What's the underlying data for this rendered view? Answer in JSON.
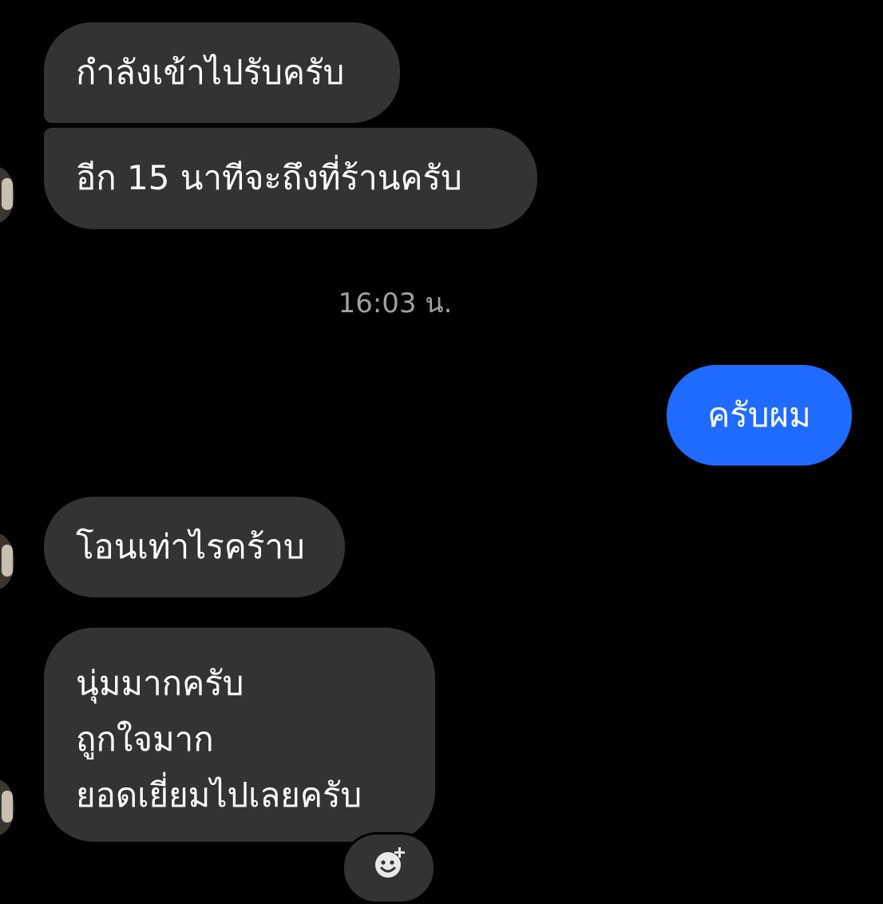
{
  "messages": {
    "incoming_1": "กำลังเข้าไปรับครับ",
    "incoming_2": "อีก 15 นาทีจะถึงที่ร้านครับ",
    "timestamp": "16:03 น.",
    "outgoing_1": "ครับผม",
    "incoming_3": "โอนเท่าไรคร้าบ",
    "incoming_4_lines": [
      "นุ่มมากครับ",
      "ถูกใจมาก",
      "ยอดเยี่ยมไปเลยครับ"
    ]
  },
  "icons": {
    "reaction": "add-reaction-icon",
    "avatar": "contact-avatar"
  },
  "colors": {
    "background": "#000000",
    "incoming_bubble": "#333333",
    "outgoing_bubble": "#1f6bff",
    "timestamp_text": "#a0a0a0"
  }
}
